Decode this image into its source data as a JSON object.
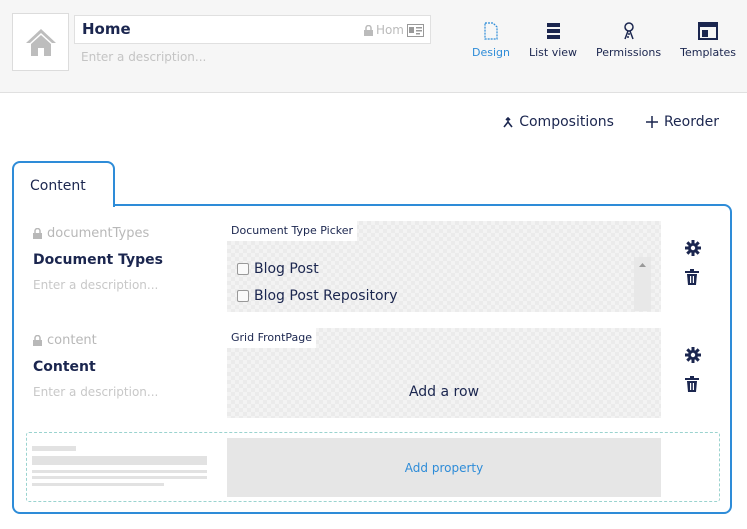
{
  "header": {
    "name": "Home",
    "alias": "Hom",
    "description_placeholder": "Enter a description...",
    "icon": "home-icon"
  },
  "app_nav": [
    {
      "label": "Design",
      "icon": "document-icon",
      "active": true
    },
    {
      "label": "List view",
      "icon": "list-icon",
      "active": false
    },
    {
      "label": "Permissions",
      "icon": "key-icon",
      "active": false
    },
    {
      "label": "Templates",
      "icon": "layout-icon",
      "active": false
    }
  ],
  "toolbar": {
    "compositions_label": "Compositions",
    "reorder_label": "Reorder"
  },
  "tab": {
    "label": "Content"
  },
  "properties": [
    {
      "alias": "documentTypes",
      "label": "Document Types",
      "description_placeholder": "Enter a description...",
      "editor": "Document Type Picker",
      "options": [
        "Blog Post",
        "Blog Post Repository"
      ]
    },
    {
      "alias": "content",
      "label": "Content",
      "description_placeholder": "Enter a description...",
      "editor": "Grid FrontPage",
      "add_row_label": "Add a row"
    }
  ],
  "add_property_label": "Add property",
  "colors": {
    "accent": "#2e8cd8",
    "text": "#1b264f",
    "dashed": "#9ad3cf"
  }
}
